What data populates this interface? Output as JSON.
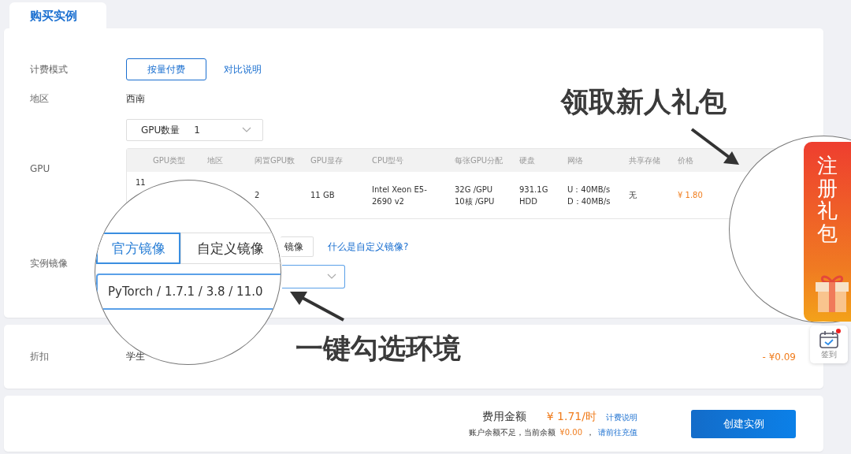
{
  "tab": {
    "label": "购买实例",
    "selected": true
  },
  "billing": {
    "label": "计费模式",
    "options": [
      {
        "label": "按量付费",
        "selected": true
      }
    ],
    "link": "对比说明"
  },
  "region": {
    "label": "地区",
    "value": "西南"
  },
  "gpu": {
    "label": "GPU",
    "count_select": {
      "label": "GPU数量",
      "value": "1"
    },
    "table": {
      "columns": [
        {
          "label": "GPU类型"
        },
        {
          "label": "地区"
        },
        {
          "label": "闲置GPU数"
        },
        {
          "label": "GPU显存"
        },
        {
          "label": "CPU型号"
        },
        {
          "label": "每张GPU分配"
        },
        {
          "label": "硬盘"
        },
        {
          "label": "网络"
        },
        {
          "label": "共享存储"
        },
        {
          "label": "价格",
          "kind": "price"
        }
      ],
      "rows": [
        {
          "cells": [
            [
              "11"
            ],
            null,
            [
              "2"
            ],
            [
              "11 GB"
            ],
            [
              "Intel Xeon E5-",
              "2690 v2"
            ],
            [
              "32G /GPU",
              "10核 /GPU"
            ],
            [
              "931.1G",
              "HDD"
            ],
            [
              "U：40MB/s",
              "D：40MB/s"
            ],
            [
              "无"
            ],
            [
              "¥ 1.80"
            ]
          ]
        }
      ]
    }
  },
  "image": {
    "label": "实例镜像",
    "tab_fragment": "镜像",
    "help_link": "什么是自定义镜像?"
  },
  "magnifier": {
    "tabs": [
      {
        "label": "官方镜像",
        "selected": true
      },
      {
        "label": "自定义镜像",
        "selected": false
      }
    ],
    "select_value": "PyTorch / 1.7.1 / 3.8 / 11.0"
  },
  "discount": {
    "label": "折扣",
    "value": "学生",
    "amount": "- ¥0.09"
  },
  "footer": {
    "label": "费用金额",
    "price": "¥ 1.71/时",
    "price_link": "计费说明",
    "balance_note": "账户余额不足，当前余额",
    "balance": "¥0.00",
    "balance_suffix": "，",
    "recharge_link": "请前往充值",
    "button": "创建实例"
  },
  "annotations": [
    {
      "text": "领取新人礼包",
      "kind": "gift"
    },
    {
      "text": "一键勾选环境",
      "kind": "image"
    }
  ],
  "gift_banner": {
    "text": "注册礼包"
  },
  "checkin": {
    "label": "签到",
    "unread": true
  }
}
